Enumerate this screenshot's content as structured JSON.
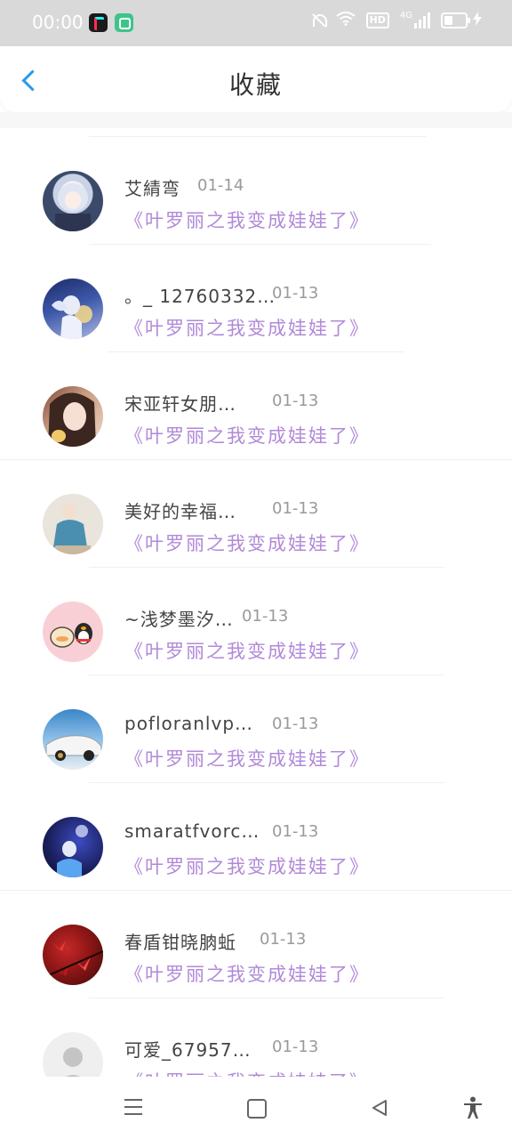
{
  "status_bar": {
    "time": "00:00",
    "hd_badge": "HD",
    "network": "4G"
  },
  "header": {
    "title": "收藏"
  },
  "favorites": [
    {
      "name": "艾綪弯",
      "date": "01-14",
      "title": "《叶罗丽之我变成娃娃了》",
      "avatar": "anime-girl-avatar"
    },
    {
      "name": "。_ 12760332…",
      "date": "01-13",
      "title": "《叶罗丽之我变成娃娃了》",
      "avatar": "anime-angel-avatar"
    },
    {
      "name": "宋亚轩女朋…",
      "date": "01-13",
      "title": "《叶罗丽之我变成娃娃了》",
      "avatar": "girl-photo-avatar"
    },
    {
      "name": "美好的幸福…",
      "date": "01-13",
      "title": "《叶罗丽之我变成娃娃了》",
      "avatar": "girl-blue-dress-avatar"
    },
    {
      "name": "~浅梦墨汐…",
      "date": "01-13",
      "title": "《叶罗丽之我变成娃娃了》",
      "avatar": "cartoon-penguin-avatar"
    },
    {
      "name": "pofloranlvp…",
      "date": "01-13",
      "title": "《叶罗丽之我变成娃娃了》",
      "avatar": "white-car-avatar"
    },
    {
      "name": "smaratfvorc…",
      "date": "01-13",
      "title": "《叶罗丽之我变成娃娃了》",
      "avatar": "concert-photo-avatar"
    },
    {
      "name": "春盾钳晓朒蚯",
      "date": "01-13",
      "title": "《叶罗丽之我变成娃娃了》",
      "avatar": "red-leaves-avatar"
    },
    {
      "name": "可爱_67957…",
      "date": "01-13",
      "title": "《叶罗丽之我变成娃娃了》",
      "avatar": "default-user-avatar"
    }
  ],
  "colors": {
    "accent": "#2b9ae6",
    "title_purple": "#b08ad8",
    "name_text": "#444444",
    "date_text": "#9a9a9a"
  }
}
